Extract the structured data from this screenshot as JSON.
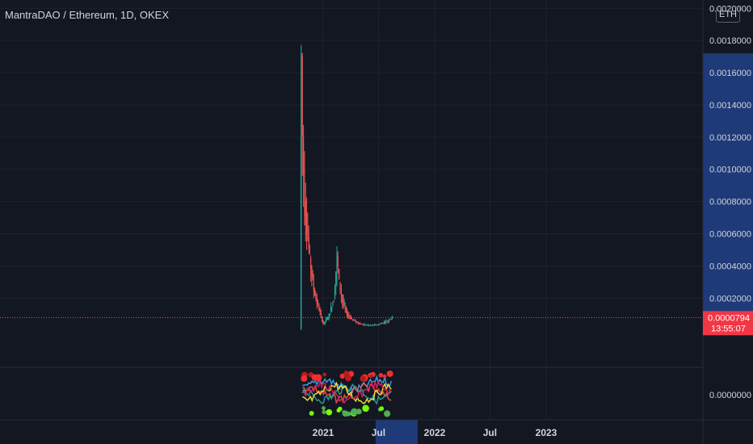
{
  "header": {
    "symbol_title": "MantraDAO / Ethereum, 1D, OKEX",
    "currency_badge": "ETH"
  },
  "price_scale": {
    "labels": [
      "0.0000000",
      "0.0002000",
      "0.0004000",
      "0.0006000",
      "0.0008000",
      "0.0010000",
      "0.0012000",
      "0.0014000",
      "0.0016000",
      "0.0018000",
      "0.0020000"
    ],
    "current_price": "0.0000794",
    "countdown": "13:55:07",
    "indicator_label": "0.0000000"
  },
  "time_axis": {
    "labels": [
      "2021",
      "Jul",
      "2022",
      "Jul",
      "2023"
    ]
  },
  "colors": {
    "background": "#131722",
    "grid": "#1e2230",
    "up": "#26a69a",
    "down": "#ef5350",
    "text": "#d1d4dc",
    "price_tag": "#f23645",
    "highlight": "#1e3a78"
  },
  "chart_data": {
    "type": "candlestick",
    "title": "MantraDAO / Ethereum, 1D, OKEX",
    "unit": "ETH",
    "ylim": [
      0,
      0.0021
    ],
    "last_price": 7.94e-05,
    "x_tick_labels": [
      "2021",
      "Jul",
      "2022",
      "Jul",
      "2023"
    ],
    "approx_close_series": {
      "dates": [
        "2020-10-20",
        "2020-10-21",
        "2020-10-25",
        "2020-11-01",
        "2020-11-15",
        "2020-12-01",
        "2020-12-15",
        "2021-01-01",
        "2021-01-20",
        "2021-02-05",
        "2021-02-15",
        "2021-02-22",
        "2021-03-05",
        "2021-03-20",
        "2021-04-05",
        "2021-05-01",
        "2021-06-01",
        "2021-07-01",
        "2021-08-01",
        "2021-08-15"
      ],
      "values": [
        1e-05,
        0.0017,
        0.0012,
        0.0008,
        0.0005,
        0.00025,
        0.00015,
        4e-05,
        9e-05,
        0.0002,
        0.00046,
        0.0003,
        0.00018,
        0.0001,
        7e-05,
        4e-05,
        3e-05,
        3.5e-05,
        6e-05,
        7.94e-05
      ]
    }
  }
}
